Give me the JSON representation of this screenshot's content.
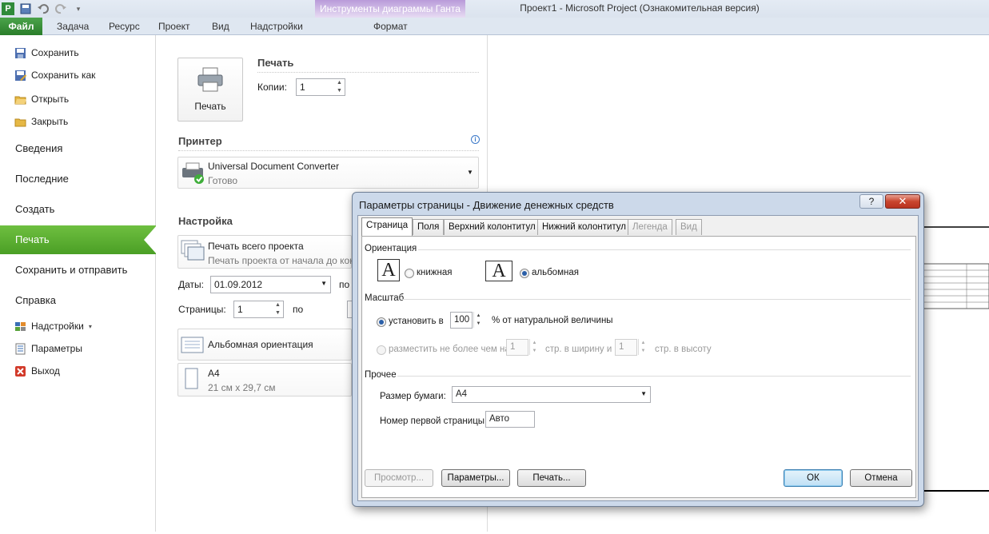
{
  "window": {
    "title": "Проект1  -  Microsoft Project (Ознакомительная версия)",
    "context_tool": "Инструменты диаграммы Ганта",
    "context_tab": "Формат",
    "app_letter": "P"
  },
  "ribbon_tabs": [
    "Файл",
    "Задача",
    "Ресурс",
    "Проект",
    "Вид",
    "Надстройки"
  ],
  "nav": {
    "save": "Сохранить",
    "save_as": "Сохранить как",
    "open": "Открыть",
    "close": "Закрыть",
    "info": "Сведения",
    "recent": "Последние",
    "new": "Создать",
    "print": "Печать",
    "save_send": "Сохранить и отправить",
    "help": "Справка",
    "addins": "Надстройки",
    "options": "Параметры",
    "exit": "Выход"
  },
  "print_panel": {
    "print_header": "Печать",
    "print_button": "Печать",
    "copies_label": "Копии:",
    "copies_value": "1",
    "printer_header": "Принтер",
    "printer_name": "Universal Document Converter",
    "printer_status": "Готово",
    "settings_header": "Настройка",
    "scope_title": "Печать всего проекта",
    "scope_sub": "Печать проекта от начала до кон",
    "dates_label": "Даты:",
    "dates_value": "01.09.2012",
    "dates_to": "по",
    "pages_label": "Страницы:",
    "pages_value": "1",
    "pages_to": "по",
    "orientation": "Альбомная ориентация",
    "paper_title": "A4",
    "paper_sub": "21 см x 29,7 см"
  },
  "dialog": {
    "title": "Параметры страницы - Движение денежных средств",
    "help": "?",
    "close": "✕",
    "tabs": [
      "Страница",
      "Поля",
      "Верхний колонтитул",
      "Нижний колонтитул",
      "Легенда",
      "Вид"
    ],
    "orientation_group": "Ориентация",
    "portrait": "книжная",
    "landscape": "альбомная",
    "orientation_icon_letter": "A",
    "scale_group": "Масштаб",
    "adjust_label": "установить в",
    "adjust_value": "100",
    "adjust_suffix": "% от натуральной величины",
    "fit_label": "разместить не более чем на",
    "fit_wide_value": "1",
    "fit_wide_suffix": "стр. в ширину и",
    "fit_tall_value": "1",
    "fit_tall_suffix": "стр. в высоту",
    "other_group": "Прочее",
    "paper_label": "Размер бумаги:",
    "paper_value": "A4",
    "first_page_label": "Номер первой страницы:",
    "first_page_value": "Авто",
    "btn_preview": "Просмотр...",
    "btn_options": "Параметры...",
    "btn_print": "Печать...",
    "btn_ok": "ОК",
    "btn_cancel": "Отмена"
  }
}
